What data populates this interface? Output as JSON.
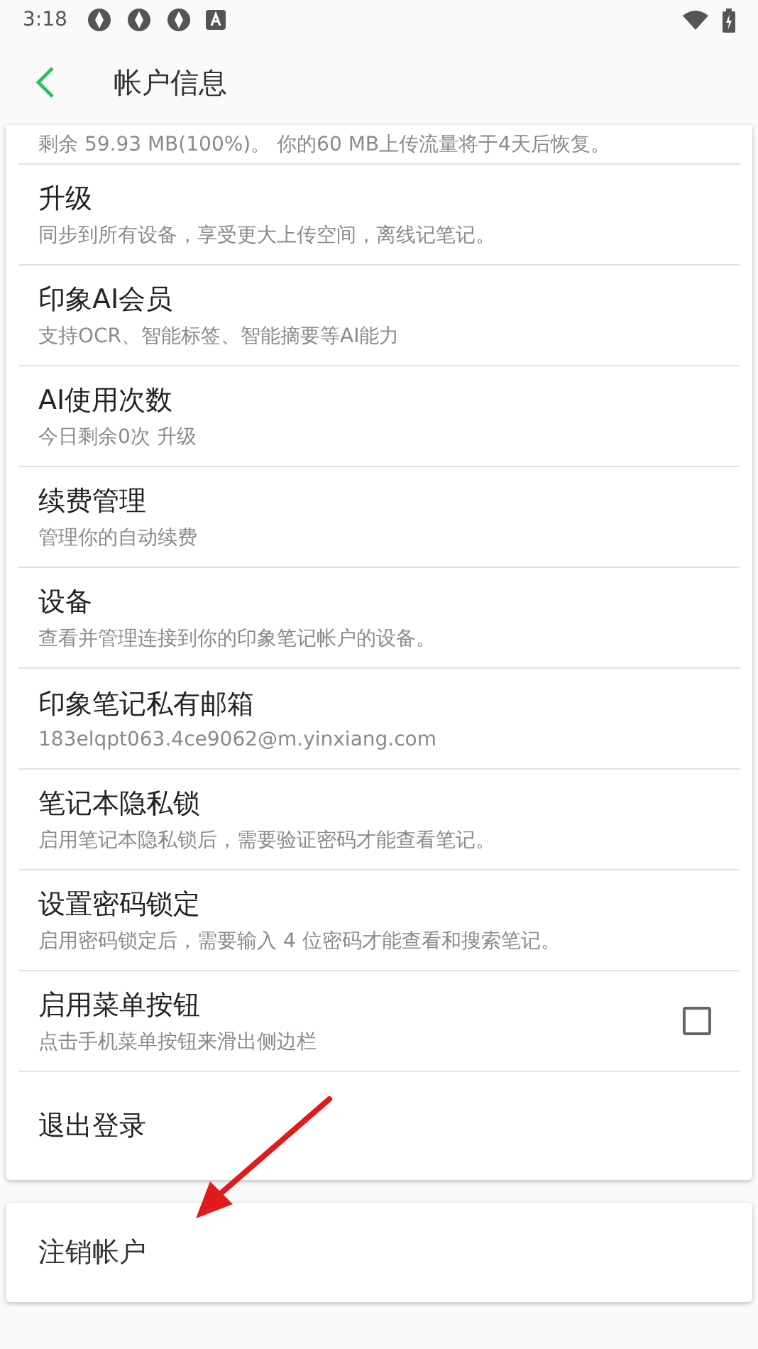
{
  "status_bar": {
    "time": "3:18",
    "notification_icons": [
      {
        "kind": "pinwheel"
      },
      {
        "kind": "pinwheel"
      },
      {
        "kind": "pinwheel"
      },
      {
        "kind": "a-box"
      }
    ]
  },
  "header": {
    "title": "帐户信息"
  },
  "settings": [
    {
      "kind": "partial",
      "subtitle": "剩余 59.93 MB(100%)。 你的60 MB上传流量将于4天后恢复。"
    },
    {
      "kind": "text",
      "title": "升级",
      "subtitle": "同步到所有设备，享受更大上传空间，离线记笔记。"
    },
    {
      "kind": "text",
      "title": "印象AI会员",
      "subtitle": "支持OCR、智能标签、智能摘要等AI能力"
    },
    {
      "kind": "text",
      "title": "AI使用次数",
      "subtitle": "今日剩余0次 升级"
    },
    {
      "kind": "text",
      "title": "续费管理",
      "subtitle": "管理你的自动续费"
    },
    {
      "kind": "text",
      "title": "设备",
      "subtitle": "查看并管理连接到你的印象笔记帐户的设备。"
    },
    {
      "kind": "text",
      "title": "印象笔记私有邮箱",
      "subtitle": "183elqpt063.4ce9062@m.yinxiang.com"
    },
    {
      "kind": "text",
      "title": "笔记本隐私锁",
      "subtitle": "启用笔记本隐私锁后，需要验证密码才能查看笔记。"
    },
    {
      "kind": "text",
      "title": "设置密码锁定",
      "subtitle": "启用密码锁定后，需要输入 4 位密码才能查看和搜索笔记。"
    },
    {
      "kind": "checkbox",
      "title": "启用菜单按钮",
      "subtitle": "点击手机菜单按钮来滑出侧边栏",
      "checked": false
    },
    {
      "kind": "action",
      "title": "退出登录"
    }
  ],
  "account_card": {
    "title": "注销帐户"
  },
  "annotation": {
    "kind": "arrow"
  }
}
